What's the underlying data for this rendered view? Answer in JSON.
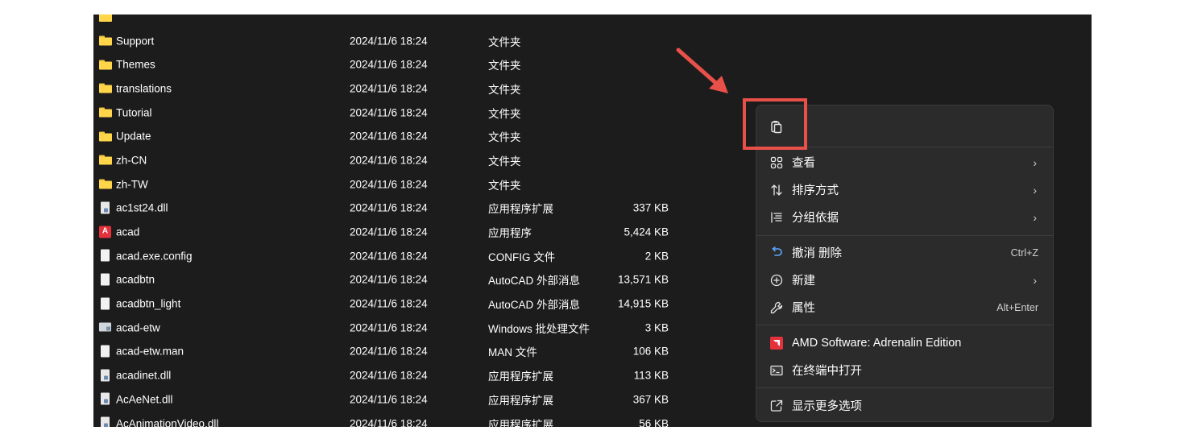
{
  "files": [
    {
      "name": "",
      "date": "",
      "type": "",
      "size": "",
      "icon": "folder-icon"
    },
    {
      "name": "Support",
      "date": "2024/11/6 18:24",
      "type": "文件夹",
      "size": "",
      "icon": "folder-icon"
    },
    {
      "name": "Themes",
      "date": "2024/11/6 18:24",
      "type": "文件夹",
      "size": "",
      "icon": "folder-icon"
    },
    {
      "name": "translations",
      "date": "2024/11/6 18:24",
      "type": "文件夹",
      "size": "",
      "icon": "folder-icon"
    },
    {
      "name": "Tutorial",
      "date": "2024/11/6 18:24",
      "type": "文件夹",
      "size": "",
      "icon": "folder-icon"
    },
    {
      "name": "Update",
      "date": "2024/11/6 18:24",
      "type": "文件夹",
      "size": "",
      "icon": "folder-icon"
    },
    {
      "name": "zh-CN",
      "date": "2024/11/6 18:24",
      "type": "文件夹",
      "size": "",
      "icon": "folder-icon"
    },
    {
      "name": "zh-TW",
      "date": "2024/11/6 18:24",
      "type": "文件夹",
      "size": "",
      "icon": "folder-icon"
    },
    {
      "name": "ac1st24.dll",
      "date": "2024/11/6 18:24",
      "type": "应用程序扩展",
      "size": "337 KB",
      "icon": "dll-file-icon"
    },
    {
      "name": "acad",
      "date": "2024/11/6 18:24",
      "type": "应用程序",
      "size": "5,424 KB",
      "icon": "autocad-app-icon"
    },
    {
      "name": "acad.exe.config",
      "date": "2024/11/6 18:24",
      "type": "CONFIG 文件",
      "size": "2 KB",
      "icon": "document-icon"
    },
    {
      "name": "acadbtn",
      "date": "2024/11/6 18:24",
      "type": "AutoCAD 外部消息",
      "size": "13,571 KB",
      "icon": "document-icon"
    },
    {
      "name": "acadbtn_light",
      "date": "2024/11/6 18:24",
      "type": "AutoCAD 外部消息",
      "size": "14,915 KB",
      "icon": "document-icon"
    },
    {
      "name": "acad-etw",
      "date": "2024/11/6 18:24",
      "type": "Windows 批处理文件",
      "size": "3 KB",
      "icon": "batch-file-icon"
    },
    {
      "name": "acad-etw.man",
      "date": "2024/11/6 18:24",
      "type": "MAN 文件",
      "size": "106 KB",
      "icon": "document-icon"
    },
    {
      "name": "acadinet.dll",
      "date": "2024/11/6 18:24",
      "type": "应用程序扩展",
      "size": "113 KB",
      "icon": "dll-file-icon"
    },
    {
      "name": "AcAeNet.dll",
      "date": "2024/11/6 18:24",
      "type": "应用程序扩展",
      "size": "367 KB",
      "icon": "dll-file-icon"
    },
    {
      "name": "AcAnimationVideo.dll",
      "date": "2024/11/6 18:24",
      "type": "应用程序扩展",
      "size": "56 KB",
      "icon": "dll-file-icon"
    }
  ],
  "context_menu": {
    "top_action": {
      "icon": "paste-icon"
    },
    "items": [
      {
        "label": "查看",
        "icon": "view-grid-icon",
        "shortcut": "",
        "submenu": true
      },
      {
        "label": "排序方式",
        "icon": "sort-icon",
        "shortcut": "",
        "submenu": true
      },
      {
        "label": "分组依据",
        "icon": "group-by-icon",
        "shortcut": "",
        "submenu": true
      },
      {
        "label": "撤消 删除",
        "icon": "undo-icon",
        "shortcut": "Ctrl+Z",
        "submenu": false
      },
      {
        "label": "新建",
        "icon": "new-plus-icon",
        "shortcut": "",
        "submenu": true
      },
      {
        "label": "属性",
        "icon": "properties-wrench-icon",
        "shortcut": "Alt+Enter",
        "submenu": false
      },
      {
        "label": "AMD Software: Adrenalin Edition",
        "icon": "amd-logo-icon",
        "shortcut": "",
        "submenu": false
      },
      {
        "label": "在终端中打开",
        "icon": "terminal-icon",
        "shortcut": "",
        "submenu": false
      },
      {
        "label": "显示更多选项",
        "icon": "show-more-options-icon",
        "shortcut": "",
        "submenu": false
      }
    ]
  },
  "colors": {
    "background": "#1c1c1c",
    "menu_background": "#2b2b2b",
    "highlight": "#e8504a",
    "amd_red": "#e3323b"
  }
}
